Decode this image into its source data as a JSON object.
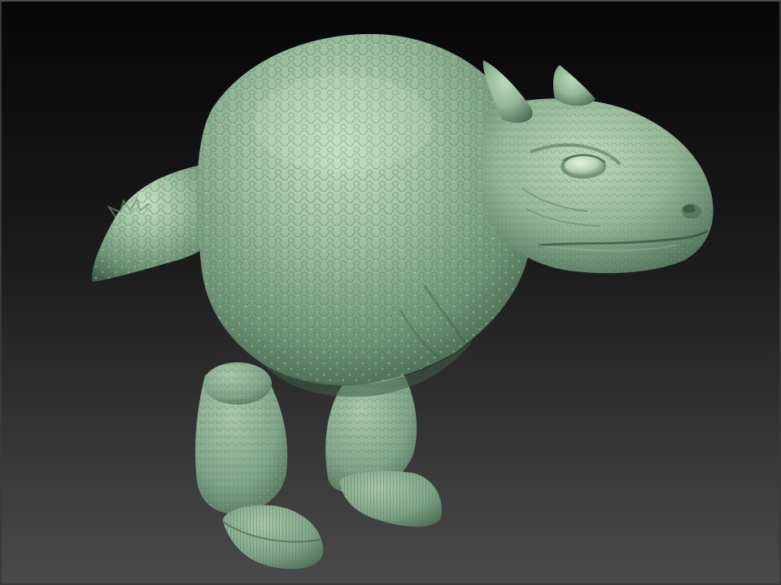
{
  "viewport": {
    "background_top": "#060606",
    "background_bottom": "#4a4a4a",
    "border_color": "#3a3a3a"
  },
  "model": {
    "subject": "sculpted-creature",
    "material_base": "#8fb594",
    "material_light": "#b9d6b8",
    "material_shadow": "#3f5f48",
    "scale_color": "#6f9677"
  }
}
